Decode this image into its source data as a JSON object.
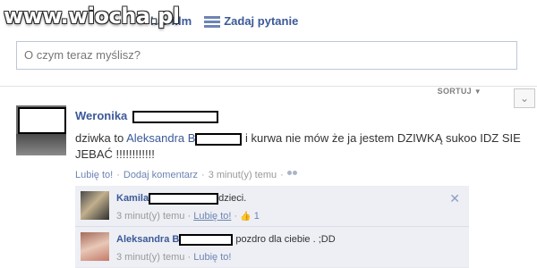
{
  "watermark": {
    "text": "www.wiocha.pl"
  },
  "composer": {
    "photo_link": "lub film",
    "question_link": "Zadaj pytanie",
    "status_placeholder": "O czym teraz myślisz?"
  },
  "feed": {
    "sort_label": "SORTUJ"
  },
  "post": {
    "author_name": "Weronika",
    "text_before": "dziwka to ",
    "tagged_name": "Aleksandra B",
    "text_after": " i kurwa nie mów że ja jestem DZIWKĄ sukoo IDZ SIE JEBAĆ !!!!!!!!!!!!",
    "like_link": "Lubię to!",
    "comment_link": "Dodaj komentarz",
    "time": "3 minut(y) temu"
  },
  "comments": [
    {
      "author_name": "Kamila",
      "text": "dzieci.",
      "time": "3 minut(y) temu",
      "like_link": "Lubię to!",
      "like_count": "1"
    },
    {
      "author_name": "Aleksandra B",
      "text": "pozdro dla ciebie . ;DD",
      "time": "3 minut(y) temu",
      "like_link": "Lubię to!"
    }
  ],
  "icons": {
    "sort_caret": "caret-down-icon",
    "sort_chevron": "chevron-down-icon",
    "audience": "people-icon",
    "like": "thumbs-up-icon",
    "close": "close-icon"
  },
  "colors": {
    "link": "#3b5998",
    "meta": "#999999",
    "comment_bg": "#edeff4"
  }
}
